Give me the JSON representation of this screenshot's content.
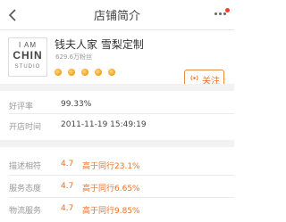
{
  "header": {
    "title": "店铺简介",
    "back_icon": "chevron-left-icon",
    "more_icon": "more-dots-icon"
  },
  "shop": {
    "logo_lines": [
      "I AM",
      "CHIN",
      "STUDIO"
    ],
    "name": "钱夫人家 雪梨定制",
    "fans": "629.6万粉丝",
    "badge_count": 5,
    "follow_label": "关注",
    "accent_color": "#f07020"
  },
  "info": [
    {
      "label": "好评率",
      "value": "99.33%"
    },
    {
      "label": "开店时间",
      "value": "2011-11-19 15:49:19"
    }
  ],
  "scores": [
    {
      "label": "描述相符",
      "score": "4.7",
      "compare": "高于同行23.1%"
    },
    {
      "label": "服务态度",
      "score": "4.7",
      "compare": "高于同行6.65%"
    },
    {
      "label": "物流服务",
      "score": "4.7",
      "compare": "高于同行9.85%"
    }
  ]
}
